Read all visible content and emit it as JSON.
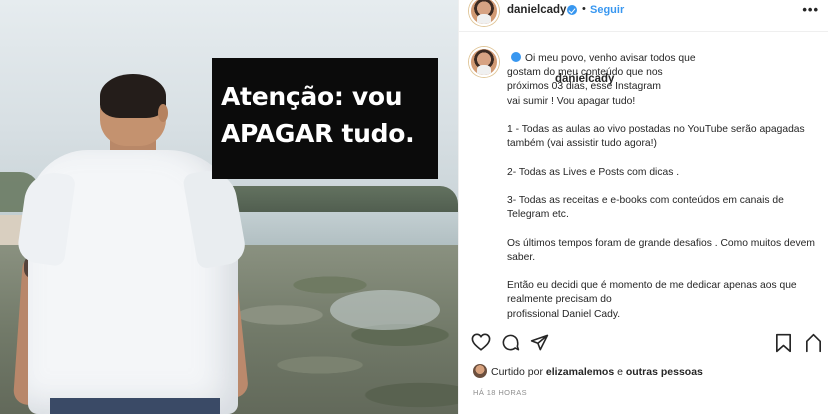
{
  "post": {
    "image_text_line1": "Atenção: vou",
    "image_text_line2": "APAGAR tudo."
  },
  "header": {
    "username": "danielcady",
    "separator": "•",
    "follow_label": "Seguir",
    "more_label": "•••"
  },
  "caption": {
    "username": "danielcady",
    "text": "Oi meu povo, venho avisar todos que\ngostam do meu conteúdo que nos\npróximos 03 dias, esse Instagram\nvai sumir ! Vou apagar tudo!\n\n1 - Todas as aulas ao vivo postadas no YouTube serão apagadas também (vai assistir tudo agora!)\n\n2- Todas as Lives e Posts com dicas .\n\n3- Todas as receitas e e-books com conteúdos em canais de Telegram etc.\n\nOs últimos tempos foram de grande desafios . Como muitos devem saber.\n\nEntão eu decidi que é momento de me dedicar apenas aos que realmente precisam do\nprofissional Daniel Cady."
  },
  "likes": {
    "prefix": "Curtido por",
    "user": "elizamalemos",
    "conjunction": "e",
    "others": "outras pessoas"
  },
  "timestamp": "HÁ 18 HORAS",
  "icons": [
    "heart-icon",
    "comment-icon",
    "share-icon",
    "bookmark-icon",
    "more-icon"
  ]
}
